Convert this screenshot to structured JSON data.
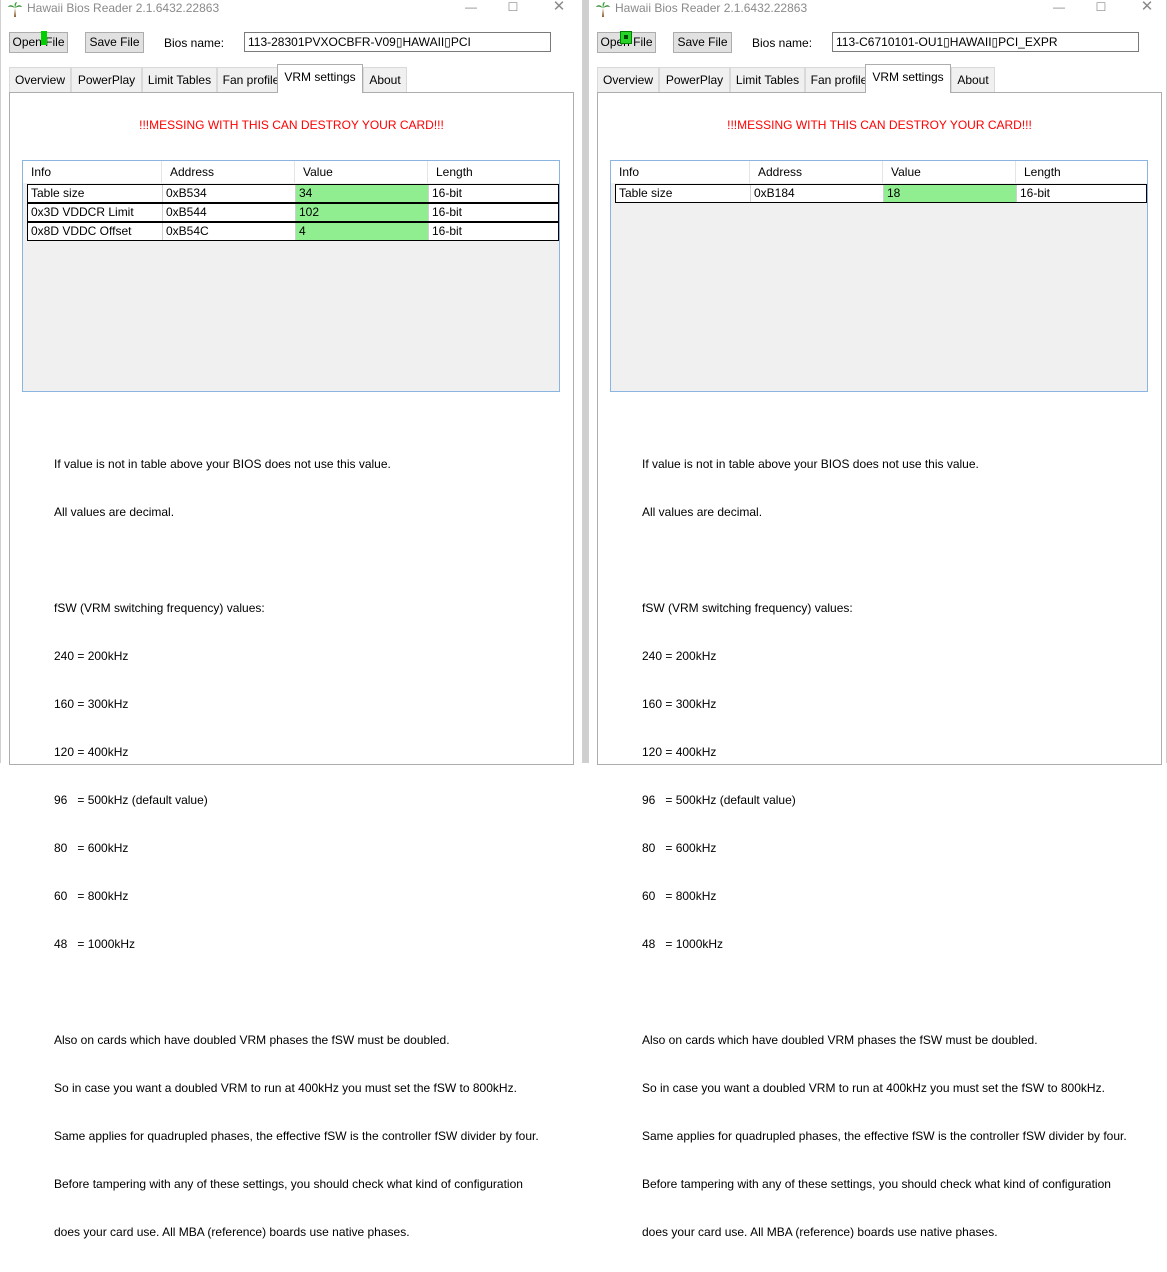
{
  "left": {
    "title": "Hawaii Bios Reader 2.1.6432.22863",
    "open_label": "Open File",
    "save_label": "Save File",
    "bios_name_label": "Bios name:",
    "bios_name_value": "113-28301PVXOCBFR-V09▯HAWAII▯PCI",
    "tabs": [
      "Overview",
      "PowerPlay",
      "Limit Tables",
      "Fan profile",
      "VRM settings",
      "About"
    ],
    "warning": "!!!MESSING WITH THIS CAN DESTROY YOUR CARD!!!",
    "columns": [
      "Info",
      "Address",
      "Value",
      "Length"
    ],
    "rows": [
      [
        "Table size",
        "0xB534",
        "34",
        "16-bit"
      ],
      [
        "0x3D VDDCR Limit",
        "0xB544",
        "102",
        "16-bit"
      ],
      [
        "0x8D VDDC Offset",
        "0xB54C",
        "4",
        "16-bit"
      ]
    ]
  },
  "right": {
    "title": "Hawaii Bios Reader 2.1.6432.22863",
    "open_label": "Open File",
    "save_label": "Save File",
    "bios_name_label": "Bios name:",
    "bios_name_value": "113-C6710101-OU1▯HAWAII▯PCI_EXPR",
    "tabs": [
      "Overview",
      "PowerPlay",
      "Limit Tables",
      "Fan profile",
      "VRM settings",
      "About"
    ],
    "warning": "!!!MESSING WITH THIS CAN DESTROY YOUR CARD!!!",
    "columns": [
      "Info",
      "Address",
      "Value",
      "Length"
    ],
    "rows": [
      [
        "Table size",
        "0xB184",
        "18",
        "16-bit"
      ]
    ]
  },
  "info_lines": [
    "If value is not in table above your BIOS does not use this value.",
    "All values are decimal.",
    "",
    "fSW (VRM switching frequency) values:",
    "240 = 200kHz",
    "160 = 300kHz",
    "120 = 400kHz",
    "96   = 500kHz (default value)",
    "80   = 600kHz",
    "60   = 800kHz",
    "48   = 1000kHz",
    "",
    "Also on cards which have doubled VRM phases the fSW must be doubled.",
    "So in case you want a doubled VRM to run at 400kHz you must set the fSW to 800kHz.",
    "Same applies for quadrupled phases, the effective fSW is the controller fSW divider by four.",
    "Before tampering with any of these settings, you should check what kind of configuration",
    "does your card use. All MBA (reference) boards use native phases."
  ],
  "icons": {
    "app": "palm-tree-icon",
    "minimize": "minimize-icon",
    "maximize": "maximize-icon",
    "close": "close-icon"
  },
  "colors": {
    "value_cell": "#90ee90",
    "warning": "#ff0000",
    "title_text": "#8a8a8a"
  }
}
